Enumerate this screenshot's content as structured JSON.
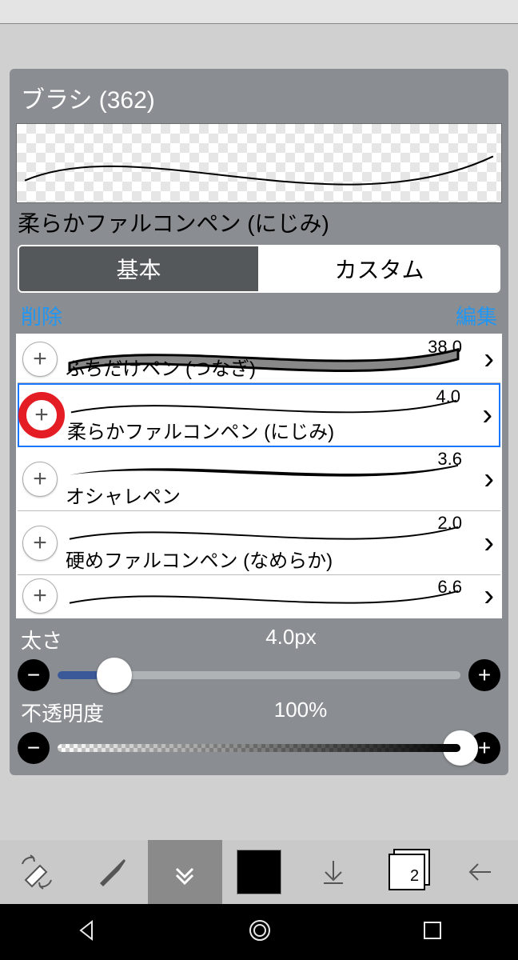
{
  "panel": {
    "title": "ブラシ (362)"
  },
  "preview": {
    "current_name": "柔らかファルコンペン (にじみ)"
  },
  "segmented": {
    "basic": "基本",
    "custom": "カスタム"
  },
  "actions": {
    "delete": "削除",
    "edit": "編集"
  },
  "brushes": [
    {
      "name": "ふちだけペン (つなぎ)",
      "size": "38.0",
      "stroke_type": "thick",
      "partial_top": true
    },
    {
      "name": "柔らかファルコンペン (にじみ)",
      "size": "4.0",
      "stroke_type": "thin",
      "selected": true,
      "highlight_plus": true
    },
    {
      "name": "オシャレペン",
      "size": "3.6",
      "stroke_type": "taper"
    },
    {
      "name": "硬めファルコンペン (なめらか)",
      "size": "2.0",
      "stroke_type": "thin"
    },
    {
      "name": "",
      "size": "6.6",
      "stroke_type": "thin",
      "partial_bottom": true
    }
  ],
  "sliders": {
    "thickness": {
      "label": "太さ",
      "value": "4.0px",
      "percent": 14
    },
    "opacity": {
      "label": "不透明度",
      "value": "100%",
      "percent": 100
    }
  },
  "toolbar": {
    "layers_count": "2"
  }
}
